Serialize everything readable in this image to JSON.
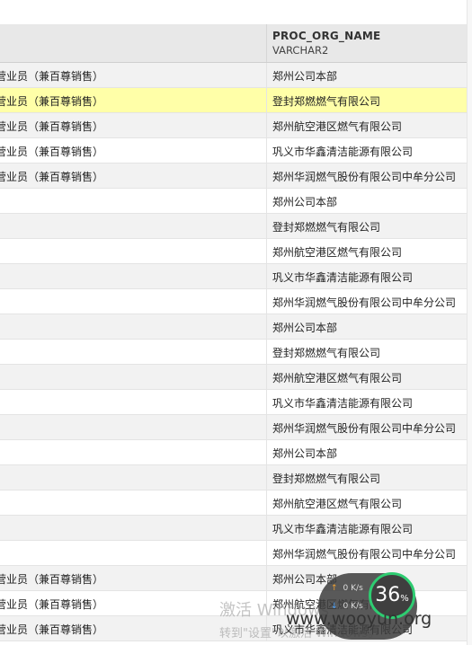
{
  "header": {
    "column_name": "PROC_ORG_NAME",
    "column_type": "VARCHAR2"
  },
  "rows": [
    {
      "a": "营业员（兼百尊销售）",
      "b": "郑州公司本部",
      "style": "alt"
    },
    {
      "a": "营业员（兼百尊销售）",
      "b": "登封郑燃燃气有限公司",
      "style": "hl"
    },
    {
      "a": "营业员（兼百尊销售）",
      "b": "郑州航空港区燃气有限公司",
      "style": "alt"
    },
    {
      "a": "营业员（兼百尊销售）",
      "b": "巩义市华鑫清洁能源有限公司",
      "style": "plain"
    },
    {
      "a": "营业员（兼百尊销售）",
      "b": "郑州华润燃气股份有限公司中牟分公司",
      "style": "alt"
    },
    {
      "a": "",
      "b": "郑州公司本部",
      "style": "plain"
    },
    {
      "a": "",
      "b": "登封郑燃燃气有限公司",
      "style": "alt"
    },
    {
      "a": "",
      "b": "郑州航空港区燃气有限公司",
      "style": "plain"
    },
    {
      "a": "",
      "b": "巩义市华鑫清洁能源有限公司",
      "style": "alt"
    },
    {
      "a": "",
      "b": "郑州华润燃气股份有限公司中牟分公司",
      "style": "plain"
    },
    {
      "a": "",
      "b": "郑州公司本部",
      "style": "alt"
    },
    {
      "a": "",
      "b": "登封郑燃燃气有限公司",
      "style": "plain"
    },
    {
      "a": "",
      "b": "郑州航空港区燃气有限公司",
      "style": "alt"
    },
    {
      "a": "",
      "b": "巩义市华鑫清洁能源有限公司",
      "style": "plain"
    },
    {
      "a": "",
      "b": "郑州华润燃气股份有限公司中牟分公司",
      "style": "alt"
    },
    {
      "a": "",
      "b": "郑州公司本部",
      "style": "plain"
    },
    {
      "a": "",
      "b": "登封郑燃燃气有限公司",
      "style": "alt"
    },
    {
      "a": "",
      "b": "郑州航空港区燃气有限公司",
      "style": "plain"
    },
    {
      "a": "",
      "b": "巩义市华鑫清洁能源有限公司",
      "style": "alt"
    },
    {
      "a": "",
      "b": "郑州华润燃气股份有限公司中牟分公司",
      "style": "plain"
    },
    {
      "a": "营业员（兼百尊销售）",
      "b": "郑州公司本部",
      "style": "alt"
    },
    {
      "a": "营业员（兼百尊销售）",
      "b": "郑州航空港区燃气有限公司",
      "style": "plain"
    },
    {
      "a": "营业员（兼百尊销售）",
      "b": "巩义市华鑫清洁能源有限公司",
      "style": "alt"
    }
  ],
  "overlay": {
    "watermark_line1": "激活 Windows",
    "watermark_line2": "转到\"设置\"以激活 Windows。",
    "site": "www.wooyun.org",
    "speed_up": "0 K/s",
    "speed_down": "0 K/s",
    "speed_percent": "36",
    "percent_symbol": "%",
    "colors": {
      "highlight": "#ffffa8",
      "alt": "#f2f2f2",
      "ring": "#2ecc71"
    }
  }
}
